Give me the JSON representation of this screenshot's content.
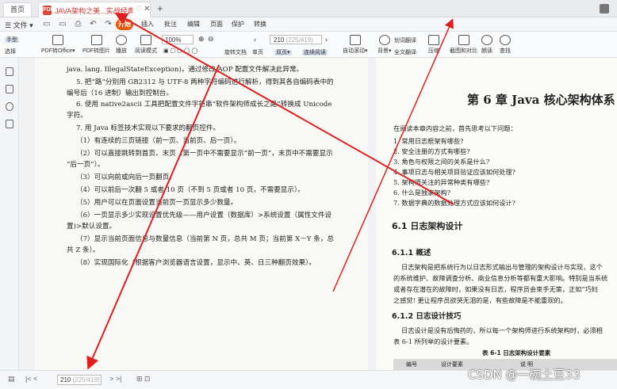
{
  "tabs": {
    "home": "首页",
    "doc_badge": "PDF",
    "doc_title": "JAVA架构之美...实战经典.pdf",
    "pin": "♡",
    "close": "✕",
    "add": "+"
  },
  "menu": {
    "file": "☰ 文件 ▾",
    "quick": "▭ ▭ ⎙ ↶ ↷ ▾",
    "start": "开始",
    "items": [
      "插入",
      "批注",
      "编辑",
      "页面",
      "保护",
      "转换"
    ]
  },
  "ribbon": {
    "hand": "手型",
    "select": "选择",
    "pdf_to_office": "PDF转Office▾",
    "pdf_to_image": "PDF转图片",
    "play": "播放",
    "read_mode": "阅读模式",
    "zoom": "100%",
    "page_current": "210",
    "page_total": "(225/419)",
    "rotate": "旋转文档",
    "single": "单页",
    "double": "双页▾",
    "continuous": "连续阅读",
    "auto_scroll": "自动滚动▾",
    "background": "背景▾",
    "translate_word": "划词翻译",
    "translate_full": "全文翻译",
    "compress": "压缩",
    "capture_compare": "截图和对比",
    "read_aloud": "朗读",
    "find": "查找"
  },
  "left_page": [
    "java. lang. IllegalStateException)，通过修改 AOP 配置文件解决此异常。",
    "5. 把“路”分别用 GB2312 与 UTF-8 两种字符编码进行解析，得到其各自编码表中的",
    "编号后（16 进制）输出到控制台。",
    "6. 使用 native2ascii 工具把配置文件字符串“软件架构师成长之路”转换成 Unicode",
    "字符。",
    "7. 用 Java 标签技术实现以下要求的翻页控件。",
    "（1）有连续的三页链接（前一页、当前页、后一页）。",
    "（2）可以直接跳转到首页、末页（第一页中不需要显示“前一页”，末页中不需要显示",
    "“后一页”）。",
    "（3）可以向前或向后一页翻页。",
    "（4）可以前后一次翻 5 或者 10 页（不到 5 页或者 10 页，不需要显示）。",
    "（5）用户可以在页面设置当前页一页显示多少数量。",
    "（6）一页显示多少实现设置优先级——用户设置（数据库）>系统设置（属性文件设",
    "置)>默认设置。",
    "（7）显示当前页面信息与数量信息（当前第 N 页，总共 M 页；当前第 X－Y 条，总",
    "共 Z 条）。",
    "（8）实现国际化（根据客户浏览器语言设置，显示中、英、日三种翻页效果）。"
  ],
  "right_page": {
    "chapter": "第 6 章   Java 核心架构体系",
    "intro": "在阅读本章内容之前，首先思考以下问题：",
    "questions": [
      "1. 常用日志框架有哪些?",
      "2. 安全注册的方式有哪些?",
      "3. 角色与权限之间的关系是什么?",
      "4. 事项日志与相关项目验证应该如何处理?",
      "5. 架构师关注的异常种类有哪些?",
      "6. 什么是独家架构?",
      "7. 数据字典的数据处理方式应该如何设计?"
    ],
    "h_6_1": "6.1  日志架构设计",
    "h_6_1_1": "6.1.1   概述",
    "p1": [
      "日志架构是把系统行为以日志形式输出与管理的架构设计与实现，这个",
      "的系统维护、故障调查分析、商业信息分析等都有重大影响。特别是当系统",
      "或者存在潜在的故障时，如果没有日志，程序员会束手无策，正如“巧妇",
      "之感觉! 更让程序员欲哭无泪的是，有些故障是不能重现的。"
    ],
    "h_6_1_2": "6.1.2   日志设计技巧",
    "p2": [
      "日志设计是没有后悔药的，所以每一个架构师进行系统架构时，必须相",
      "表 6-1 所列举的设计要素。"
    ],
    "table_caption": "表 6-1   日志架构设计要素",
    "table_headers": [
      "编号",
      "设计要素",
      "说   明"
    ]
  },
  "status": {
    "page_current": "210",
    "page_total": "(225/419)",
    "nav_prev": "|<  <",
    "nav_next": ">  >|"
  },
  "watermark": "CSDN @一碗土豆33"
}
